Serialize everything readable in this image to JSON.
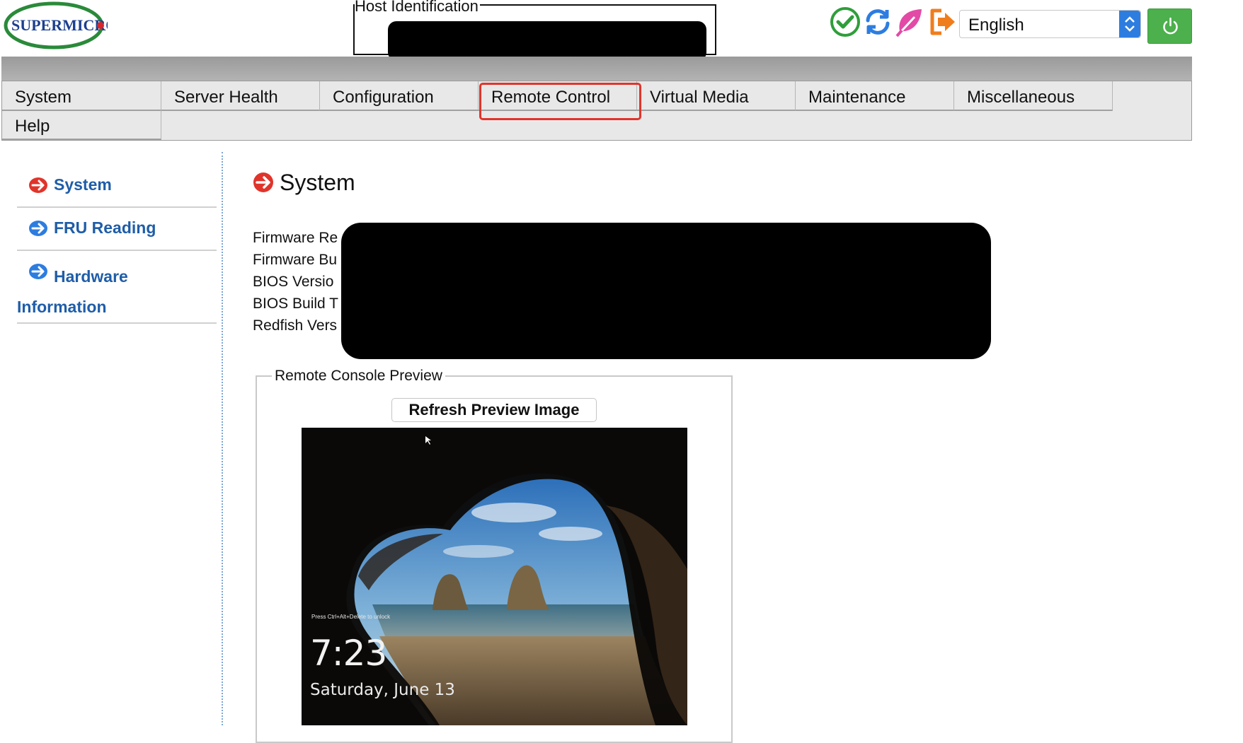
{
  "header": {
    "brand": "SUPERMICRO",
    "host_identification_label": "Host Identification",
    "language": "English",
    "icons": [
      "check-circle-icon",
      "refresh-icon",
      "leaf-icon",
      "logout-icon"
    ],
    "power_icon": "power-icon"
  },
  "nav": {
    "tabs": [
      {
        "label": "System"
      },
      {
        "label": "Server Health"
      },
      {
        "label": "Configuration"
      },
      {
        "label": "Remote Control",
        "highlighted": true
      },
      {
        "label": "Virtual Media"
      },
      {
        "label": "Maintenance"
      },
      {
        "label": "Miscellaneous"
      },
      {
        "label": "Help"
      }
    ]
  },
  "sidebar": {
    "items": [
      {
        "label": "System",
        "icon": "arrow-right-red-icon",
        "active": true
      },
      {
        "label": "FRU Reading",
        "icon": "arrow-right-blue-icon"
      },
      {
        "label": "Hardware Information",
        "icon": "arrow-right-blue-icon"
      }
    ]
  },
  "main": {
    "title": "System",
    "info_labels": [
      "Firmware Re",
      "Firmware Bu",
      "BIOS Versio",
      "BIOS Build T",
      "Redfish Vers"
    ],
    "console": {
      "legend": "Remote Console Preview",
      "refresh_button": "Refresh Preview Image",
      "preview": {
        "hint": "Press Ctrl+Alt+Delete to unlock",
        "time": "7:23",
        "date": "Saturday, June 13"
      }
    }
  },
  "colors": {
    "accent_red": "#e0342b",
    "link_blue": "#1f5da8",
    "power_green": "#4cb04c",
    "select_blue": "#2d7de0"
  }
}
